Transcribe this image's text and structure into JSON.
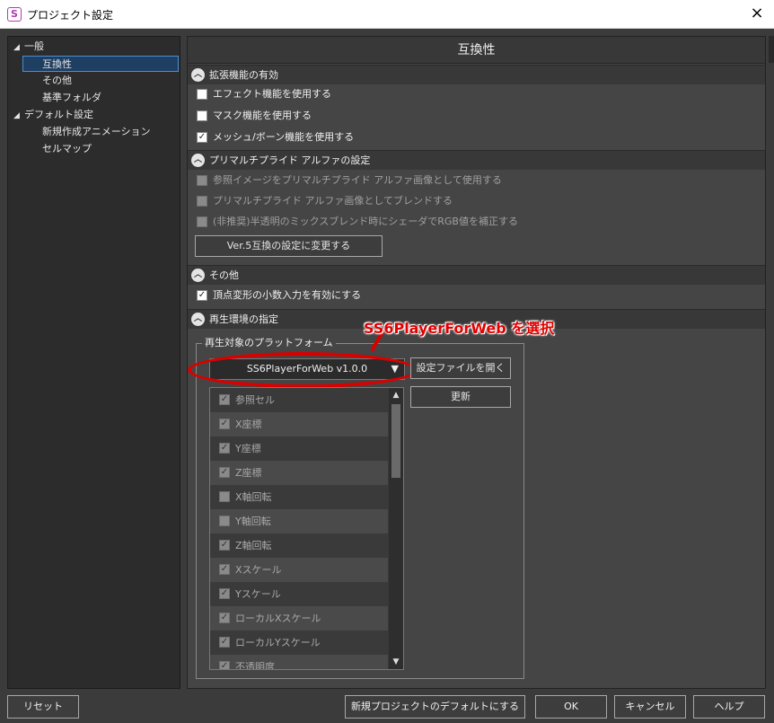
{
  "window": {
    "title": "プロジェクト設定",
    "app_icon": "S",
    "close": "×"
  },
  "tree": [
    {
      "label": "一般",
      "arrow": "◢"
    },
    {
      "label": "互換性",
      "arrow": ""
    },
    {
      "label": "その他",
      "arrow": ""
    },
    {
      "label": "基準フォルダ",
      "arrow": ""
    },
    {
      "label": "デフォルト設定",
      "arrow": "◢"
    },
    {
      "label": "新規作成アニメーション",
      "arrow": ""
    },
    {
      "label": "セルマップ",
      "arrow": ""
    }
  ],
  "panel": {
    "title": "互換性",
    "extensions": {
      "header": "拡張機能の有効",
      "effect": "エフェクト機能を使用する",
      "mask": "マスク機能を使用する",
      "mesh": "メッシュ/ボーン機能を使用する"
    },
    "premultiplied": {
      "header": "プリマルチプライド アルファの設定",
      "ref_image": "参照イメージをプリマルチプライド アルファ画像として使用する",
      "blend": "プリマルチプライド アルファ画像としてブレンドする",
      "mix": "(非推奨)半透明のミックスブレンド時にシェーダでRGB値を補正する",
      "ver5_button": "Ver.5互換の設定に変更する"
    },
    "other": {
      "header": "その他",
      "decimal": "頂点変形の小数入力を有効にする"
    },
    "playback": {
      "header": "再生環境の指定",
      "group_title": "再生対象のプラットフォーム",
      "platform": "SS6PlayerForWeb v1.0.0",
      "combo_arrow": "▼",
      "open_settings": "設定ファイルを開く",
      "update": "更新",
      "annotation": "SS6PlayerForWeb を選択",
      "scroll_up": "▲",
      "scroll_down": "▼",
      "attributes": [
        {
          "label": "参照セル",
          "checked": "✓"
        },
        {
          "label": "X座標",
          "checked": "✓"
        },
        {
          "label": "Y座標",
          "checked": "✓"
        },
        {
          "label": "Z座標",
          "checked": "✓"
        },
        {
          "label": "X軸回転",
          "checked": ""
        },
        {
          "label": "Y軸回転",
          "checked": ""
        },
        {
          "label": "Z軸回転",
          "checked": "✓"
        },
        {
          "label": "Xスケール",
          "checked": "✓"
        },
        {
          "label": "Yスケール",
          "checked": "✓"
        },
        {
          "label": "ローカルXスケール",
          "checked": "✓"
        },
        {
          "label": "ローカルYスケール",
          "checked": "✓"
        },
        {
          "label": "不透明度",
          "checked": "✓"
        }
      ]
    }
  },
  "buttons": {
    "reset": "リセット",
    "default": "新規プロジェクトのデフォルトにする",
    "ok": "OK",
    "cancel": "キャンセル",
    "help": "ヘルプ"
  },
  "checks": {
    "on": "✓",
    "off": ""
  },
  "colors": {
    "accent_selection": "#1f3f62",
    "callout": "#d90000"
  }
}
